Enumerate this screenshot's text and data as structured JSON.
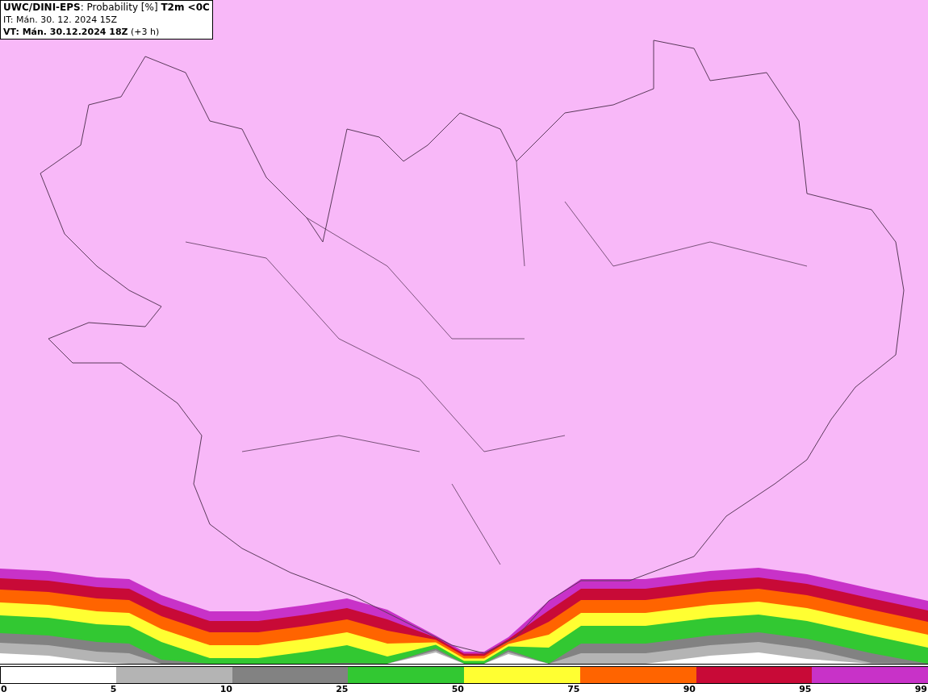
{
  "header": {
    "lines": [
      "**UWC/DINI-EPS**: Probability [%] **T2m <0C**",
      "IT: Mán. 30. 12. 2024 15Z",
      "**VT: Mán. 30.12.2024 18Z** (+3 h)"
    ]
  },
  "legend": {
    "segments": [
      {
        "color": "#ffffff"
      },
      {
        "color": "#b4b4b4"
      },
      {
        "color": "#828282"
      },
      {
        "color": "#32c832"
      },
      {
        "color": "#ffff32"
      },
      {
        "color": "#ff6400"
      },
      {
        "color": "#c80a37"
      },
      {
        "color": "#c832c8"
      }
    ],
    "ticks": [
      "0",
      "5",
      "10",
      "25",
      "50",
      "75",
      "90",
      "95",
      "99"
    ]
  }
}
